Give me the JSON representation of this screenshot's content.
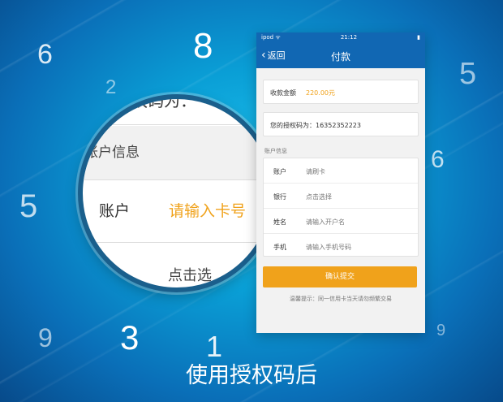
{
  "background": {
    "numbers": [
      "6",
      "2",
      "8",
      "5",
      "5",
      "6",
      "9",
      "3",
      "1",
      "9"
    ]
  },
  "magnifier": {
    "top_partial": "权码为：",
    "account_info": "账户信息",
    "account_label": "账户",
    "account_placeholder": "请输入卡号",
    "bottom_partial": "点击选"
  },
  "phone": {
    "status": {
      "carrier": "ipod ᯤ",
      "time": "21:12",
      "battery": "▮"
    },
    "nav": {
      "back_label": "返回",
      "title": "付款"
    },
    "amount": {
      "label": "收款金额",
      "value": "220.00元"
    },
    "auth_code": "您的授权码为：16352352223",
    "section_label": "账户信息",
    "fields": [
      {
        "label": "账户",
        "placeholder": "请刷卡"
      },
      {
        "label": "银行",
        "placeholder": "点击选择"
      },
      {
        "label": "姓名",
        "placeholder": "请输入开户名"
      },
      {
        "label": "手机",
        "placeholder": "请输入手机号码"
      }
    ],
    "submit_label": "确认提交",
    "tip": "温馨提示：同一信用卡当天请勿频繁交易"
  },
  "caption": "使用授权码后",
  "colors": {
    "accent": "#f0a21b",
    "nav_blue": "#1167b3",
    "ring": "#1a5f8c"
  }
}
